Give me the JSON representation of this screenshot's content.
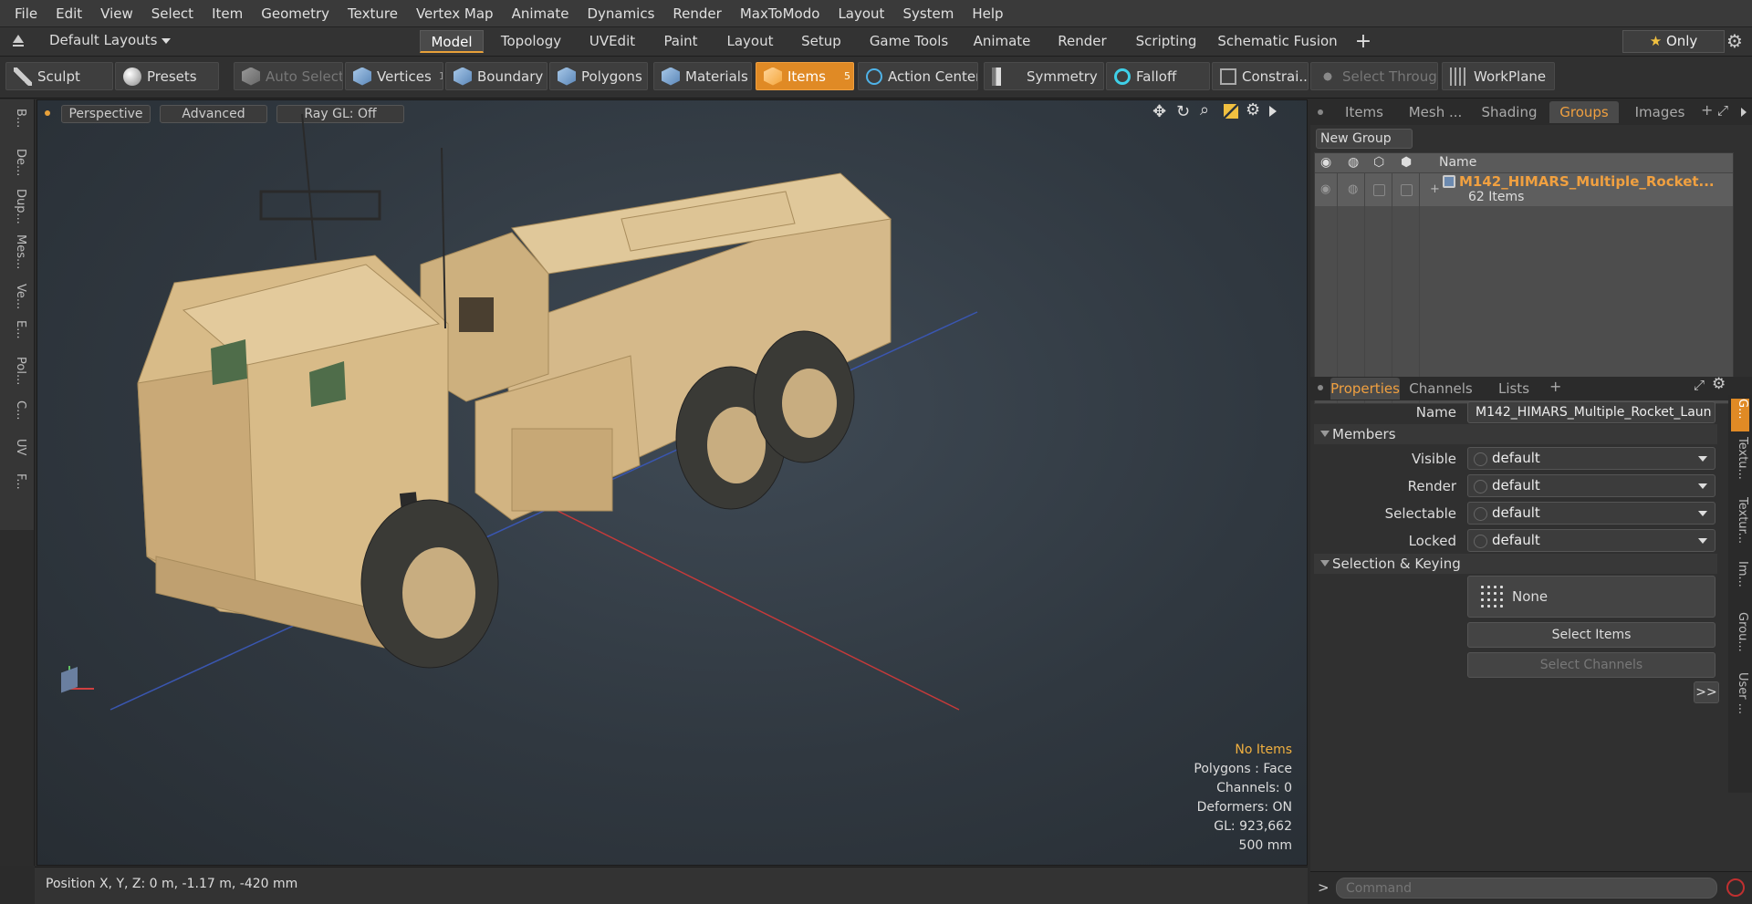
{
  "menu": [
    "File",
    "Edit",
    "View",
    "Select",
    "Item",
    "Geometry",
    "Texture",
    "Vertex Map",
    "Animate",
    "Dynamics",
    "Render",
    "MaxToModo",
    "Layout",
    "System",
    "Help"
  ],
  "layouts": {
    "preset": "Default Layouts",
    "tabs": [
      "Model",
      "Topology",
      "UVEdit",
      "Paint",
      "Layout",
      "Setup",
      "Game Tools",
      "Animate",
      "Render",
      "Scripting",
      "Schematic Fusion"
    ],
    "active": "Model",
    "add": "+",
    "only": "Only"
  },
  "toolbar": {
    "sculpt": "Sculpt",
    "presets": "Presets",
    "auto_select": "Auto Select",
    "vertices": "Vertices",
    "vertices_count": "1",
    "boundary": "Boundary",
    "polygons": "Polygons",
    "materials": "Materials",
    "items": "Items",
    "items_count": "5",
    "action_center": "Action Center",
    "symmetry": "Symmetry",
    "falloff": "Falloff",
    "constraints": "Constrai...",
    "select_through": "Select Through",
    "workplane": "WorkPlane"
  },
  "left_tabs": [
    "B...",
    "De...",
    "Dup...",
    "Mes...",
    "Ve...",
    "E...",
    "Pol...",
    "C...",
    "UV",
    "F..."
  ],
  "viewport": {
    "view_mode": "Perspective",
    "shading": "Advanced",
    "raygl": "Ray GL: Off",
    "info": {
      "selection": "No Items",
      "polygons": "Polygons : Face",
      "channels": "Channels: 0",
      "deformers": "Deformers: ON",
      "gl": "GL: 923,662",
      "scale": "500 mm"
    }
  },
  "status": {
    "position": "Position X, Y, Z:  0 m, -1.17 m, -420 mm"
  },
  "top_panel": {
    "tabs": [
      "Items",
      "Mesh ...",
      "Shading",
      "Groups",
      "Images"
    ],
    "active": "Groups",
    "new_group": "New Group",
    "col_name": "Name",
    "group_name": "M142_HIMARS_Multiple_Rocket...",
    "group_count": "62 Items"
  },
  "properties": {
    "tabs": [
      "Properties",
      "Channels",
      "Lists"
    ],
    "active": "Properties",
    "name_label": "Name",
    "name_value": "M142_HIMARS_Multiple_Rocket_Laun",
    "members_header": "Members",
    "rows": [
      {
        "label": "Visible",
        "value": "default"
      },
      {
        "label": "Render",
        "value": "default"
      },
      {
        "label": "Selectable",
        "value": "default"
      },
      {
        "label": "Locked",
        "value": "default"
      }
    ],
    "selection_header": "Selection & Keying",
    "none": "None",
    "select_items": "Select Items",
    "select_channels": "Select Channels",
    "more": ">>"
  },
  "side_tabs": [
    "G...",
    "Textu...",
    "Textur...",
    "Im...",
    "Grou...",
    "User ..."
  ],
  "command": {
    "placeholder": "Command",
    "prompt": ">"
  }
}
